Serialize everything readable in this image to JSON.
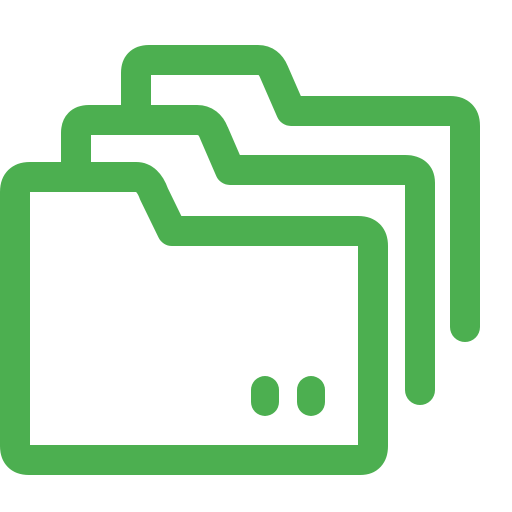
{
  "icon": {
    "name": "stacked-folders-icon",
    "color": "#4CAF50",
    "folder_count": 3,
    "indicator_dots": 2
  }
}
